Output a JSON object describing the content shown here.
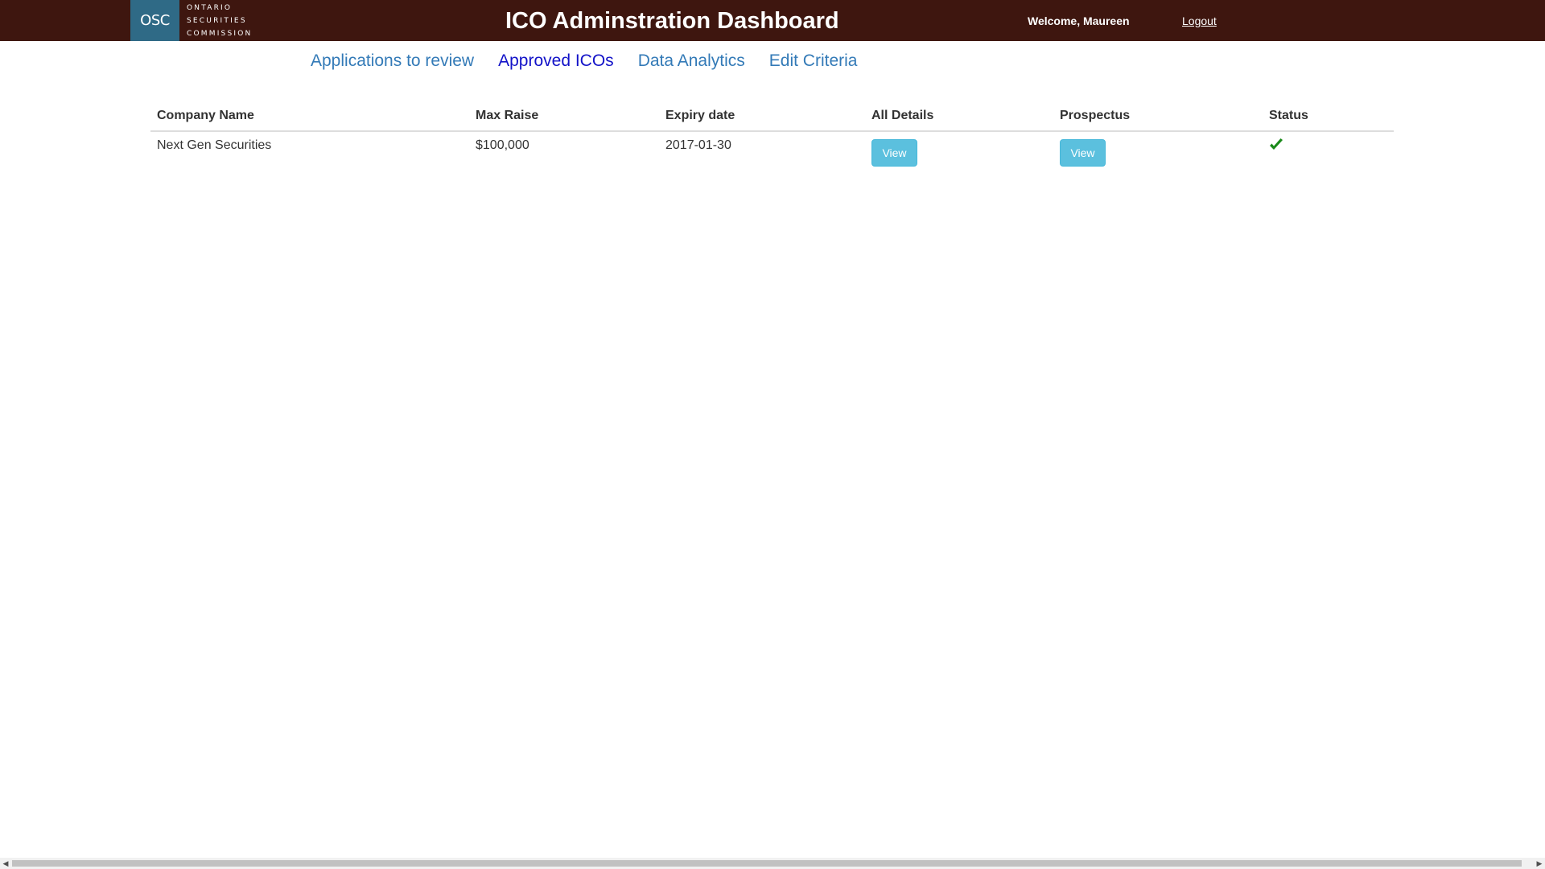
{
  "header": {
    "logo_abbrev": "OSC",
    "logo_lines": [
      "ONTARIO",
      "SECURITIES",
      "COMMISSION"
    ],
    "title": "ICO Adminstration Dashboard",
    "welcome": "Welcome, Maureen",
    "logout": "Logout"
  },
  "nav": {
    "tabs": [
      {
        "label": "Applications to review",
        "active": false
      },
      {
        "label": "Approved ICOs",
        "active": true
      },
      {
        "label": "Data Analytics",
        "active": false
      },
      {
        "label": "Edit Criteria",
        "active": false
      }
    ]
  },
  "table": {
    "headers": [
      "Company Name",
      "Max Raise",
      "Expiry date",
      "All Details",
      "Prospectus",
      "Status"
    ],
    "rows": [
      {
        "company": "Next Gen Securities",
        "max_raise": "$100,000",
        "expiry": "2017-01-30",
        "details_button": "View",
        "prospectus_button": "View",
        "status": "approved"
      }
    ]
  },
  "colors": {
    "topbar": "#3e160f",
    "logo_box": "#2f6a86",
    "link": "#337ab7",
    "link_active": "#1212c8",
    "button": "#5bc0de",
    "status_check": "#1a8a1a"
  },
  "icons": {
    "status": "checkmark-icon",
    "scroll_left": "scroll-left-arrow-icon",
    "scroll_right": "scroll-right-arrow-icon"
  }
}
